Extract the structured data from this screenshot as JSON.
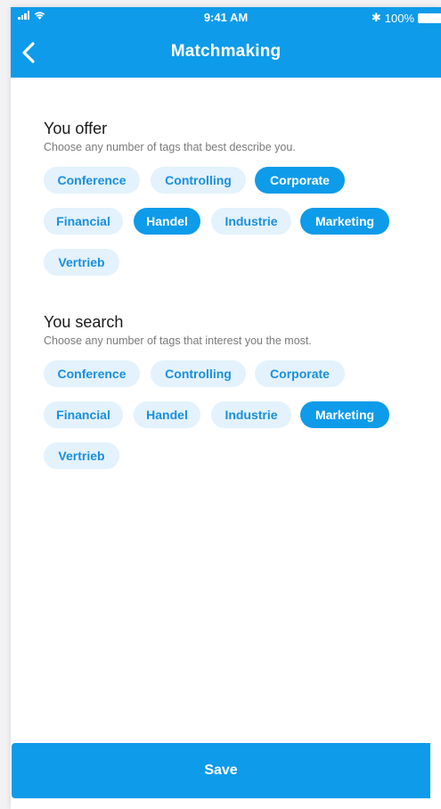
{
  "status_bar": {
    "time": "9:41 AM",
    "battery": "100%",
    "bluetooth_icon": "bluetooth-icon"
  },
  "nav": {
    "title": "Matchmaking",
    "back_icon": "chevron-left-icon"
  },
  "offer": {
    "title": "You offer",
    "subtitle": "Choose any number of tags that best describe you.",
    "tags": [
      {
        "label": "Conference",
        "selected": false
      },
      {
        "label": "Controlling",
        "selected": false
      },
      {
        "label": "Corporate",
        "selected": true
      },
      {
        "label": "Financial",
        "selected": false
      },
      {
        "label": "Handel",
        "selected": true
      },
      {
        "label": "Industrie",
        "selected": false
      },
      {
        "label": "Marketing",
        "selected": true
      },
      {
        "label": "Vertrieb",
        "selected": false
      }
    ]
  },
  "search": {
    "title": "You search",
    "subtitle": "Choose any number of tags that interest you the most.",
    "tags": [
      {
        "label": "Conference",
        "selected": false
      },
      {
        "label": "Controlling",
        "selected": false
      },
      {
        "label": "Corporate",
        "selected": false
      },
      {
        "label": "Financial",
        "selected": false
      },
      {
        "label": "Handel",
        "selected": false
      },
      {
        "label": "Industrie",
        "selected": false
      },
      {
        "label": "Marketing",
        "selected": true
      },
      {
        "label": "Vertrieb",
        "selected": false
      }
    ]
  },
  "footer": {
    "save_label": "Save"
  },
  "colors": {
    "accent": "#0d9bea",
    "tag_background": "#e3f2fc",
    "tag_text": "#1a8fe0"
  }
}
